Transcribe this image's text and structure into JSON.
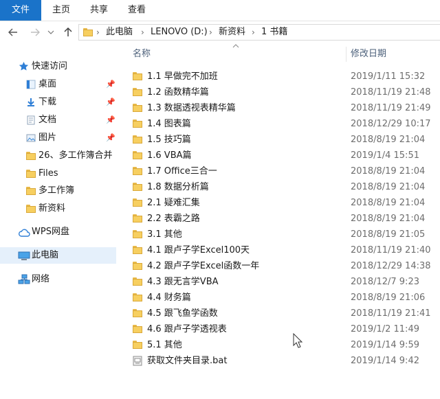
{
  "ribbon": {
    "tabs": [
      "文件",
      "主页",
      "共享",
      "查看"
    ]
  },
  "address": {
    "crumbs": [
      "此电脑",
      "LENOVO (D:)",
      "新资料",
      "1 书籍"
    ],
    "separator": "›"
  },
  "columns": {
    "name": "名称",
    "date": "修改日期"
  },
  "sidebar": {
    "quick_access": "快速访问",
    "quick_items": [
      {
        "label": "桌面",
        "icon": "desktop-icon",
        "pinned": true
      },
      {
        "label": "下载",
        "icon": "download-icon",
        "pinned": true
      },
      {
        "label": "文档",
        "icon": "document-icon",
        "pinned": true
      },
      {
        "label": "图片",
        "icon": "picture-icon",
        "pinned": true
      },
      {
        "label": "26、多工作簿合并",
        "icon": "folder-icon",
        "pinned": false
      },
      {
        "label": "Files",
        "icon": "folder-icon",
        "pinned": false
      },
      {
        "label": "多工作簿",
        "icon": "folder-icon",
        "pinned": false
      },
      {
        "label": "新资料",
        "icon": "folder-icon",
        "pinned": false
      }
    ],
    "wps": "WPS网盘",
    "this_pc": "此电脑",
    "network": "网络"
  },
  "files": [
    {
      "name": "1.1 早做完不加班",
      "date": "2019/1/11 15:32",
      "type": "folder"
    },
    {
      "name": "1.2 函数精华篇",
      "date": "2018/11/19 21:48",
      "type": "folder"
    },
    {
      "name": "1.3 数据透视表精华篇",
      "date": "2018/11/19 21:49",
      "type": "folder"
    },
    {
      "name": "1.4 图表篇",
      "date": "2018/12/29 10:17",
      "type": "folder"
    },
    {
      "name": "1.5 技巧篇",
      "date": "2018/8/19 21:04",
      "type": "folder"
    },
    {
      "name": "1.6 VBA篇",
      "date": "2019/1/4 15:51",
      "type": "folder"
    },
    {
      "name": "1.7 Office三合一",
      "date": "2018/8/19 21:04",
      "type": "folder"
    },
    {
      "name": "1.8 数据分析篇",
      "date": "2018/8/19 21:04",
      "type": "folder"
    },
    {
      "name": "2.1 疑难汇集",
      "date": "2018/8/19 21:04",
      "type": "folder"
    },
    {
      "name": "2.2 表霸之路",
      "date": "2018/8/19 21:04",
      "type": "folder"
    },
    {
      "name": "3.1 其他",
      "date": "2018/8/19 21:05",
      "type": "folder"
    },
    {
      "name": "4.1 跟卢子学Excel100天",
      "date": "2018/11/19 21:40",
      "type": "folder"
    },
    {
      "name": "4.2 跟卢子学Excel函数一年",
      "date": "2018/12/29 14:38",
      "type": "folder"
    },
    {
      "name": "4.3 跟无言学VBA",
      "date": "2018/12/7 9:23",
      "type": "folder"
    },
    {
      "name": "4.4 财务篇",
      "date": "2018/8/19 21:06",
      "type": "folder"
    },
    {
      "name": "4.5 跟飞鱼学函数",
      "date": "2018/11/19 21:41",
      "type": "folder"
    },
    {
      "name": "4.6 跟卢子学透视表",
      "date": "2019/1/2 11:49",
      "type": "folder"
    },
    {
      "name": "5.1 其他",
      "date": "2019/1/14 9:59",
      "type": "folder"
    },
    {
      "name": "获取文件夹目录.bat",
      "date": "2019/1/14 9:42",
      "type": "bat"
    }
  ]
}
